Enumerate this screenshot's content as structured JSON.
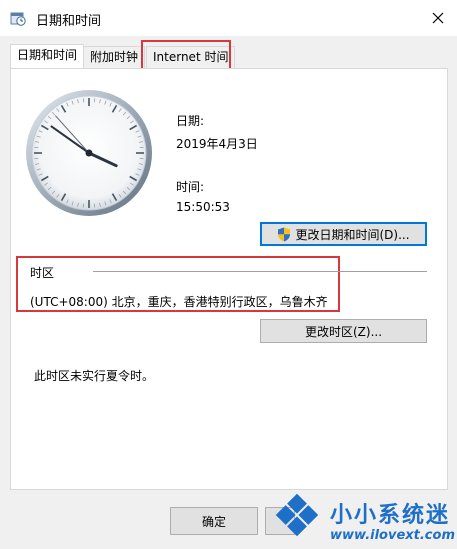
{
  "window": {
    "title": "日期和时间"
  },
  "tabs": [
    {
      "label": "日期和时间"
    },
    {
      "label": "附加时钟"
    },
    {
      "label": "Internet 时间"
    }
  ],
  "date_section": {
    "label": "日期:",
    "value": "2019年4月3日"
  },
  "time_section": {
    "label": "时间:",
    "value": "15:50:53"
  },
  "clock": {
    "hour": 15,
    "minute": 50,
    "second": 53
  },
  "buttons": {
    "change_datetime": "更改日期和时间(D)...",
    "change_timezone": "更改时区(Z)...",
    "ok": "确定"
  },
  "timezone": {
    "header": "时区",
    "value": "(UTC+08:00) 北京，重庆，香港特别行政区，乌鲁木齐"
  },
  "dst_note": "此时区未实行夏令时。",
  "watermark": {
    "brand": "小小系统迷",
    "url": "www.ilovext.com"
  },
  "colors": {
    "highlight_box": "#d9373d",
    "focus_blue": "#0078d7",
    "watermark_blue": "#1e6fc8"
  }
}
